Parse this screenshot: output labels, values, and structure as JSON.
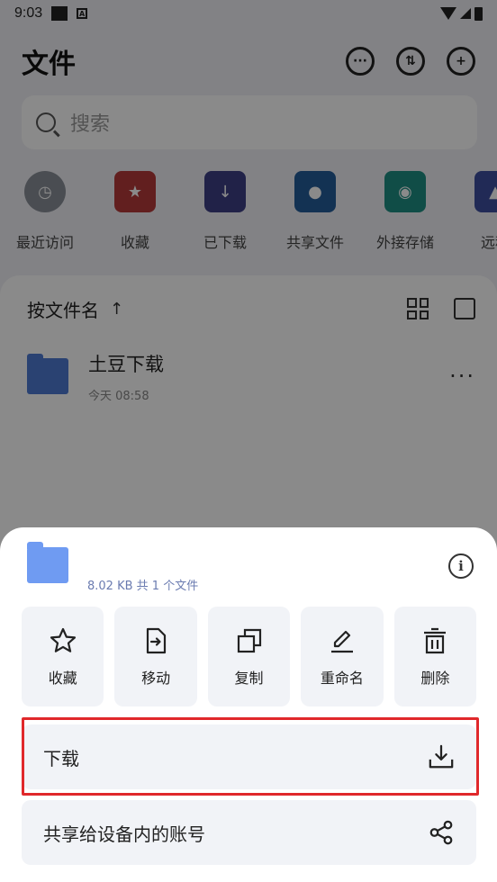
{
  "status_bar": {
    "time": "9:03"
  },
  "header": {
    "title": "文件"
  },
  "search": {
    "placeholder": "搜索"
  },
  "quick_access": [
    {
      "label": "最近访问",
      "icon": "clock-icon",
      "color": "#8a8f98"
    },
    {
      "label": "收藏",
      "icon": "star-folder-icon",
      "color": "#b53a3a"
    },
    {
      "label": "已下载",
      "icon": "download-folder-icon",
      "color": "#3d3f86"
    },
    {
      "label": "共享文件",
      "icon": "shared-folder-icon",
      "color": "#235d9a"
    },
    {
      "label": "外接存储",
      "icon": "external-drive-icon",
      "color": "#1f8f83"
    },
    {
      "label": "远程",
      "icon": "remote-icon",
      "color": "#3d4fa0"
    }
  ],
  "list": {
    "sort_label": "按文件名",
    "sort_arrow": "↑",
    "files": [
      {
        "name": "土豆下载",
        "time": "今天 08:58"
      }
    ]
  },
  "sheet": {
    "info_text": "8.02 KB 共 1 个文件",
    "actions": [
      {
        "label": "收藏",
        "icon": "star-icon"
      },
      {
        "label": "移动",
        "icon": "move-icon"
      },
      {
        "label": "复制",
        "icon": "copy-icon"
      },
      {
        "label": "重命名",
        "icon": "rename-icon"
      },
      {
        "label": "删除",
        "icon": "delete-icon"
      }
    ],
    "download_label": "下载",
    "share_label": "共享给设备内的账号"
  },
  "colors": {
    "highlight": "#e0282b",
    "folder": "#6f9bf2",
    "sheet_button_bg": "#f1f3f7"
  }
}
